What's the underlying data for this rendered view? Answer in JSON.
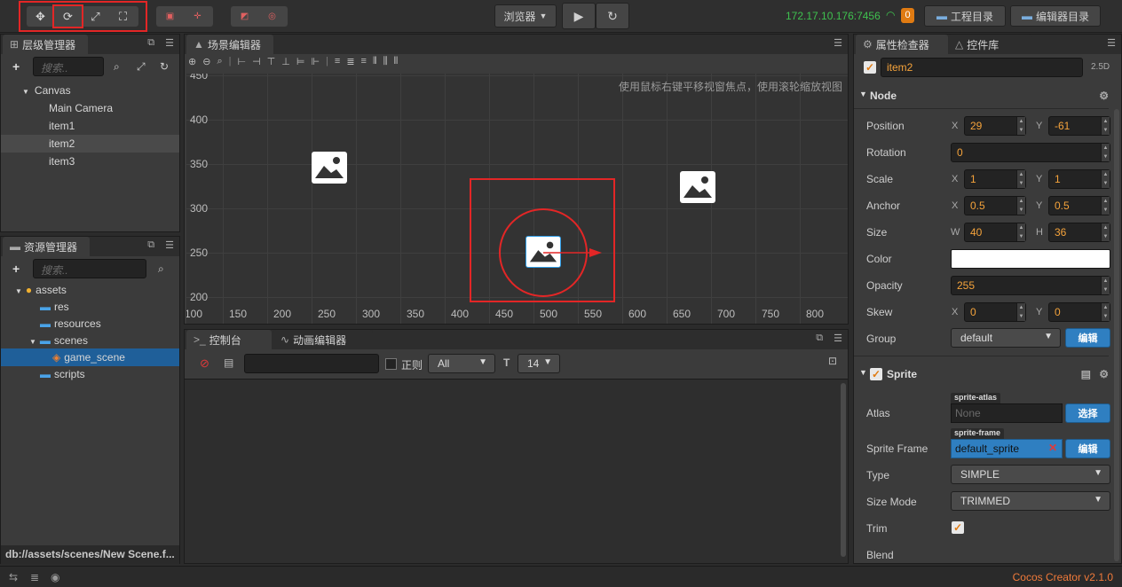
{
  "toolbar": {
    "browser_label": "浏览器",
    "ip": "172.17.10.176:7456",
    "badge": "0",
    "project_dir": "工程目录",
    "editor_dir": "编辑器目录"
  },
  "hierarchy": {
    "title": "层级管理器",
    "search_placeholder": "搜索..",
    "items": [
      "Canvas",
      "Main Camera",
      "item1",
      "item2",
      "item3"
    ]
  },
  "assets": {
    "title": "资源管理器",
    "search_placeholder": "搜索..",
    "items": [
      "assets",
      "res",
      "resources",
      "scenes",
      "game_scene",
      "scripts"
    ],
    "path": "db://assets/scenes/New Scene.f..."
  },
  "scene": {
    "title": "场景编辑器",
    "hint": "使用鼠标右键平移视窗焦点，使用滚轮缩放视图",
    "y_ticks": [
      "450",
      "400",
      "350",
      "300",
      "250",
      "200"
    ],
    "x_ticks": [
      "100",
      "150",
      "200",
      "250",
      "300",
      "350",
      "400",
      "450",
      "500",
      "550",
      "600",
      "650",
      "700",
      "750",
      "800"
    ]
  },
  "console": {
    "tab_console": "控制台",
    "tab_anim": "动画编辑器",
    "regex_label": "正则",
    "level": "All",
    "font_size": "14"
  },
  "inspector": {
    "tab_props": "属性检查器",
    "tab_widgets": "控件库",
    "node_name": "item2",
    "mode": "2.5D",
    "node_section": "Node",
    "position_label": "Position",
    "pos_x": "29",
    "pos_y": "-61",
    "rotation_label": "Rotation",
    "rotation": "0",
    "scale_label": "Scale",
    "scale_x": "1",
    "scale_y": "1",
    "anchor_label": "Anchor",
    "anchor_x": "0.5",
    "anchor_y": "0.5",
    "size_label": "Size",
    "size_w": "40",
    "size_h": "36",
    "color_label": "Color",
    "opacity_label": "Opacity",
    "opacity": "255",
    "skew_label": "Skew",
    "skew_x": "0",
    "skew_y": "0",
    "group_label": "Group",
    "group": "default",
    "edit_label": "编辑",
    "sprite_section": "Sprite",
    "atlas_label": "Atlas",
    "atlas_tag": "sprite-atlas",
    "atlas_value": "None",
    "select_label": "选择",
    "frame_label": "Sprite Frame",
    "frame_tag": "sprite-frame",
    "frame_value": "default_sprite",
    "type_label": "Type",
    "type_value": "SIMPLE",
    "sizemode_label": "Size Mode",
    "sizemode_value": "TRIMMED",
    "trim_label": "Trim",
    "blend_label": "Blend",
    "axis": {
      "x": "X",
      "y": "Y",
      "w": "W",
      "h": "H"
    }
  },
  "status": {
    "version": "Cocos Creator v2.1.0"
  },
  "colors": {
    "accent": "#2f7fc1",
    "highlight": "#e32626",
    "value": "#f5a33b",
    "ip": "#3fc14f"
  }
}
